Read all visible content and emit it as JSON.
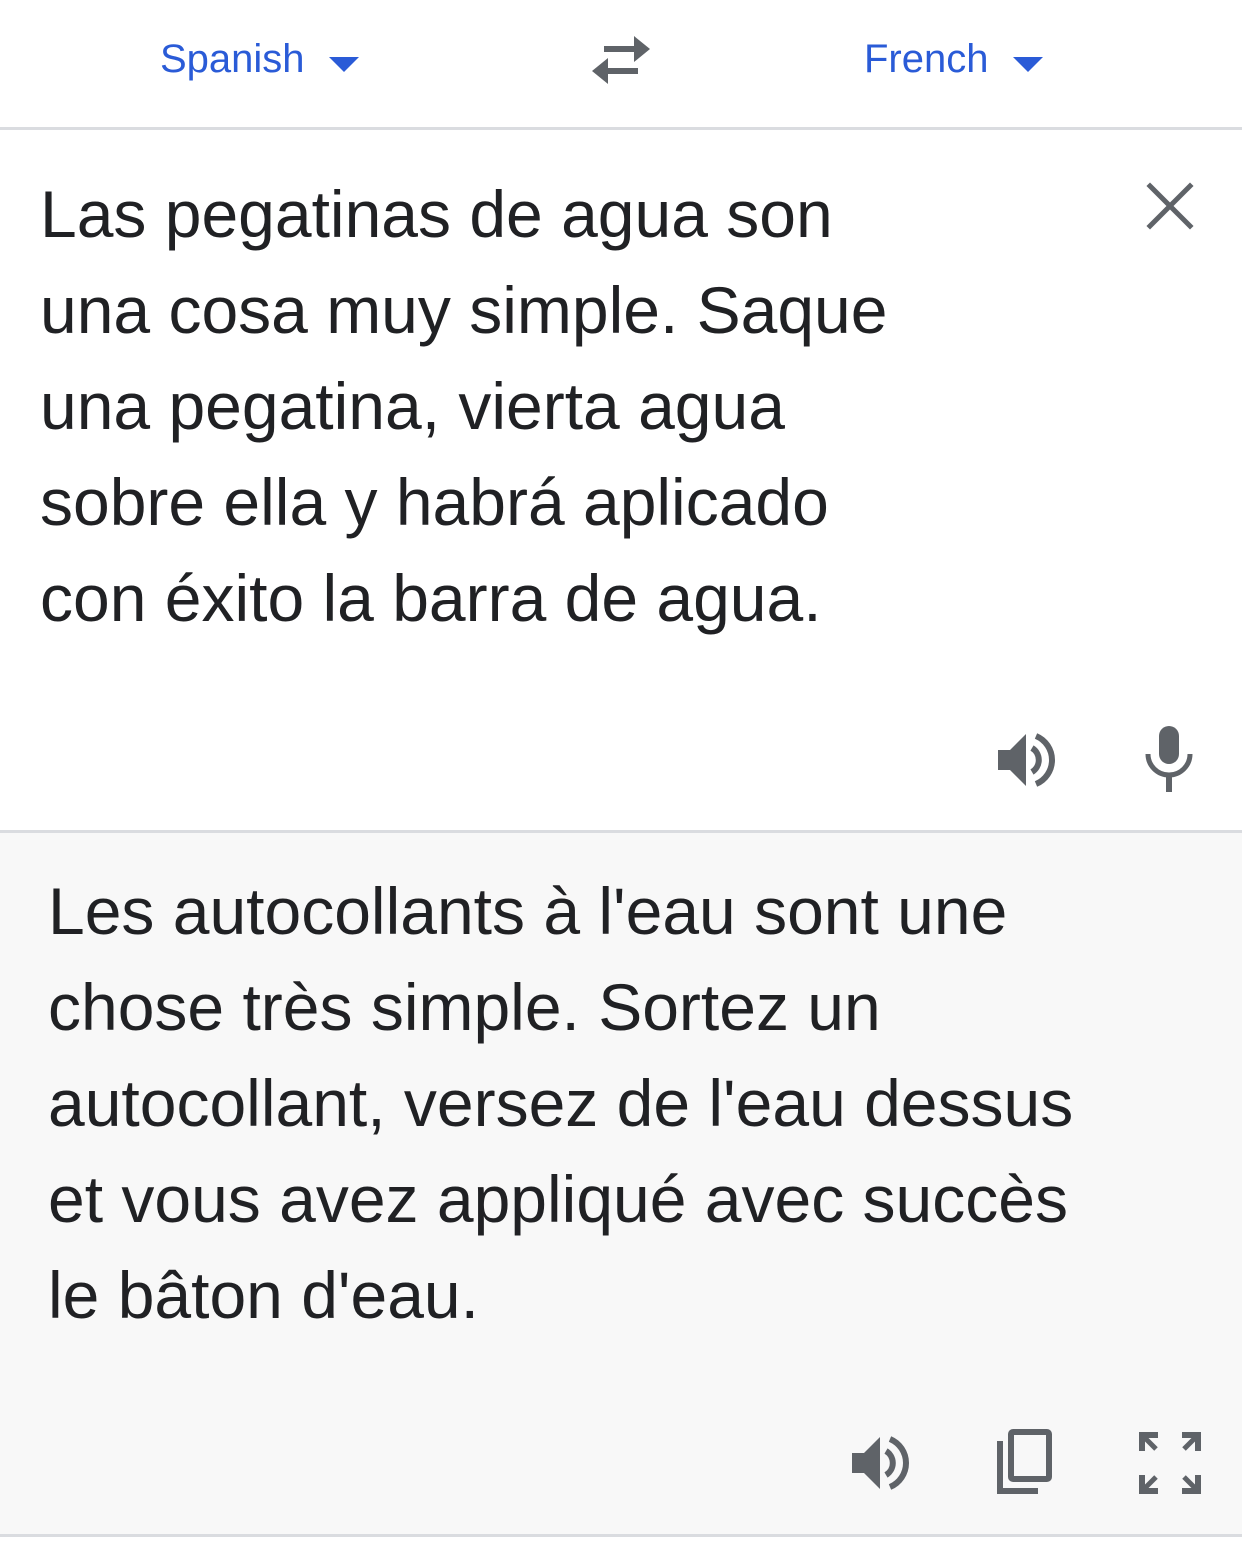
{
  "language_bar": {
    "source_language": "Spanish",
    "target_language": "French",
    "swap_icon": "swap-horiz-icon",
    "accent_color": "#2a5bd7"
  },
  "source": {
    "text": "Las pegatinas de agua son\nuna cosa muy simple. Saque\nuna pegatina, vierta agua\nsobre ella y habrá aplicado\ncon éxito la barra de agua.",
    "clear_icon": "close-icon",
    "listen_icon": "speaker-icon",
    "mic_icon": "microphone-icon"
  },
  "translation": {
    "text": "Les autocollants à l'eau sont une\nchose très simple. Sortez un\nautocollant, versez de l'eau dessus\net vous avez appliqué avec succès\nle bâton d'eau.",
    "listen_icon": "speaker-icon",
    "copy_icon": "copy-icon",
    "fullscreen_icon": "fullscreen-icon",
    "background_color": "#f8f8f8"
  }
}
